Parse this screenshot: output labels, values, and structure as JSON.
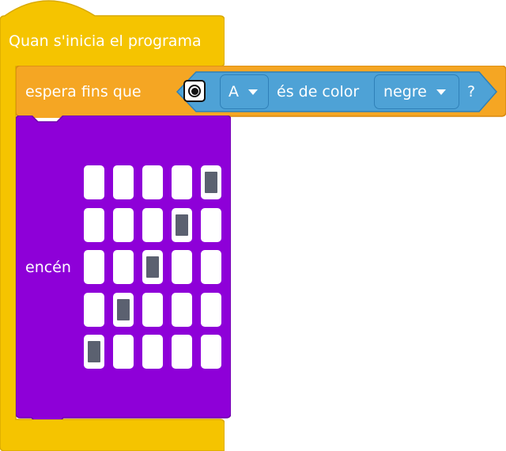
{
  "hat_block": {
    "label": "Quan s'inicia el programa",
    "color": "#f5c400"
  },
  "wait_block": {
    "label": "espera fins que",
    "color": "#f5a623",
    "sensor_icon": "color-sensor-icon",
    "port": {
      "value": "A"
    },
    "condition_text": "és de color",
    "color_choice": {
      "value": "negre"
    },
    "question_mark": "?",
    "inner_color": "#4ea2d6"
  },
  "light_block": {
    "label": "encén",
    "color": "#8e00d8",
    "matrix_rows": 5,
    "matrix_cols": 5,
    "lit_cells": [
      [
        0,
        4
      ],
      [
        1,
        3
      ],
      [
        2,
        2
      ],
      [
        3,
        1
      ],
      [
        4,
        0
      ]
    ],
    "lit_color": "#5b6170"
  }
}
